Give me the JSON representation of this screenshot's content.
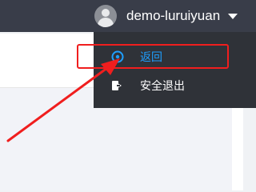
{
  "header": {
    "username": "demo-luruiyuan",
    "avatar_icon": "user-avatar-icon",
    "caret_icon": "caret-down-icon"
  },
  "dropdown": {
    "items": [
      {
        "label": "返回",
        "icon": "back-circle-icon",
        "color": "#1e9fff"
      },
      {
        "label": "安全退出",
        "icon": "logout-icon",
        "color": "#ffffff"
      }
    ]
  },
  "annotation": {
    "color": "#f01e1e"
  },
  "theme": {
    "topbar_bg": "#393d49",
    "dropdown_bg": "#2f3238",
    "page_bg": "#f0f2f5",
    "accent": "#1e9fff"
  }
}
